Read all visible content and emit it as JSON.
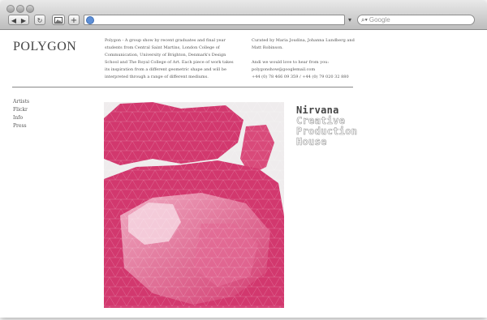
{
  "browser": {
    "search_placeholder": "Google",
    "back_glyph": "◀",
    "forward_glyph": "▶",
    "reload_glyph": "↻",
    "add_glyph": "+",
    "url_arrow_glyph": "▾",
    "search_glyph": "⌕▾",
    "accent_color": "#5e8fd6"
  },
  "site": {
    "logo": "POLYGON",
    "intro": "Polygon - A group show by recent graduates and final year students from Central Saint Martins, London College of Communication, University of Brighton, Denmark's Design School and The Royal College of Art. Each piece of work takes its inspiration from a different geometric shape and will be interpreted through a range of different mediums.",
    "curated_line": "Curated by Maria Joudina, Johanna Lundberg and Matt Robinson.",
    "contact_line": "Andi we would love to hear from you:",
    "email": "polygonshow@googlemail.com",
    "phones": "+44 (0) 78 466 09 359 / +44 (0) 79 020 32 880"
  },
  "nav": {
    "items": [
      {
        "label": "Artists"
      },
      {
        "label": "Flickr"
      },
      {
        "label": "Info"
      },
      {
        "label": "Press"
      }
    ]
  },
  "feature": {
    "title_line1": "Nirvana",
    "title_line2": "Creative",
    "title_line3": "Production",
    "title_line4": "House",
    "art_colors": {
      "pink": "#d2386e",
      "light_pink": "#e88fae",
      "background": "#efeced"
    }
  }
}
